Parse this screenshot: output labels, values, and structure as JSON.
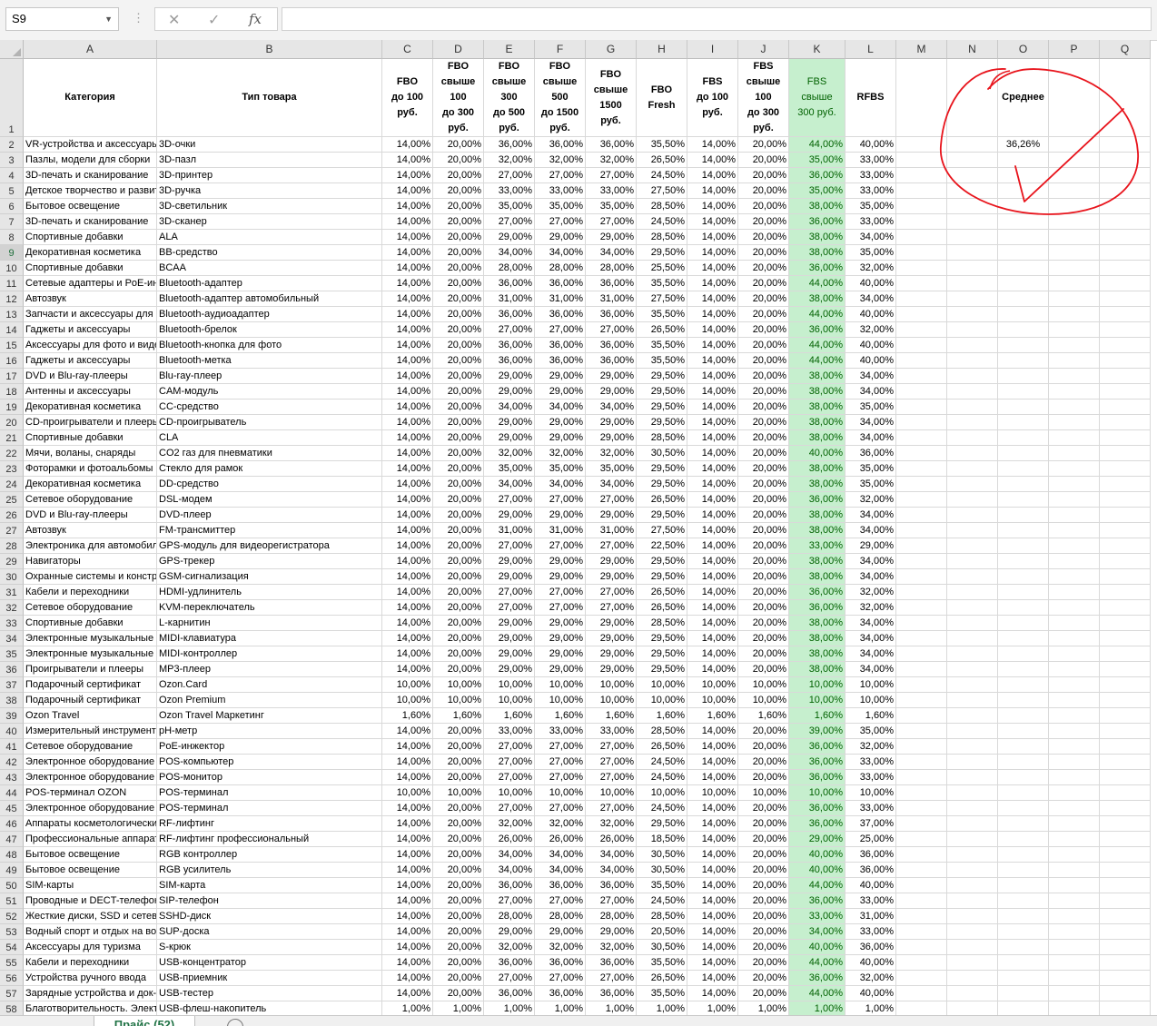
{
  "formula_bar": {
    "name_box": "S9",
    "cancel_icon": "cancel-icon",
    "enter_icon": "check-icon",
    "fx_label": "fx",
    "formula": ""
  },
  "selection": {
    "column": "S",
    "row": "9"
  },
  "columns": [
    "A",
    "B",
    "C",
    "D",
    "E",
    "F",
    "G",
    "H",
    "I",
    "J",
    "K",
    "L",
    "M",
    "N",
    "O",
    "P",
    "Q"
  ],
  "header_row": {
    "A": "Категория",
    "B": "Тип товара",
    "C": [
      "FBO",
      "до 100",
      "руб."
    ],
    "D": [
      "FBO",
      "свыше",
      "100",
      "до 300",
      "руб."
    ],
    "E": [
      "FBO",
      "свыше",
      "300",
      "до 500",
      "руб."
    ],
    "F": [
      "FBO",
      "свыше",
      "500",
      "до 1500",
      "руб."
    ],
    "G": [
      "FBO",
      "свыше",
      "1500",
      "руб."
    ],
    "H": [
      "FBO Fresh"
    ],
    "I": [
      "FBS",
      "до 100",
      "руб."
    ],
    "J": [
      "FBS",
      "свыше",
      "100",
      "до 300",
      "руб."
    ],
    "K": [
      "FBS",
      "свыше",
      "300 руб."
    ],
    "L": [
      "RFBS"
    ],
    "O": "Среднее"
  },
  "average_value": "36,26%",
  "rows": [
    [
      "VR-устройства и аксессуары",
      "3D-очки",
      "14,00%",
      "20,00%",
      "36,00%",
      "36,00%",
      "36,00%",
      "35,50%",
      "14,00%",
      "20,00%",
      "44,00%",
      "40,00%"
    ],
    [
      "Пазлы, модели для сборки",
      "3D-пазл",
      "14,00%",
      "20,00%",
      "32,00%",
      "32,00%",
      "32,00%",
      "26,50%",
      "14,00%",
      "20,00%",
      "35,00%",
      "33,00%"
    ],
    [
      "3D-печать и сканирование",
      "3D-принтер",
      "14,00%",
      "20,00%",
      "27,00%",
      "27,00%",
      "27,00%",
      "24,50%",
      "14,00%",
      "20,00%",
      "36,00%",
      "33,00%"
    ],
    [
      "Детское творчество и развитие",
      "3D-ручка",
      "14,00%",
      "20,00%",
      "33,00%",
      "33,00%",
      "33,00%",
      "27,50%",
      "14,00%",
      "20,00%",
      "35,00%",
      "33,00%"
    ],
    [
      "Бытовое освещение",
      "3D-светильник",
      "14,00%",
      "20,00%",
      "35,00%",
      "35,00%",
      "35,00%",
      "28,50%",
      "14,00%",
      "20,00%",
      "38,00%",
      "35,00%"
    ],
    [
      "3D-печать и сканирование",
      "3D-сканер",
      "14,00%",
      "20,00%",
      "27,00%",
      "27,00%",
      "27,00%",
      "24,50%",
      "14,00%",
      "20,00%",
      "36,00%",
      "33,00%"
    ],
    [
      "Спортивные добавки",
      "ALA",
      "14,00%",
      "20,00%",
      "29,00%",
      "29,00%",
      "29,00%",
      "28,50%",
      "14,00%",
      "20,00%",
      "38,00%",
      "34,00%"
    ],
    [
      "Декоративная косметика",
      "BB-средство",
      "14,00%",
      "20,00%",
      "34,00%",
      "34,00%",
      "34,00%",
      "29,50%",
      "14,00%",
      "20,00%",
      "38,00%",
      "35,00%"
    ],
    [
      "Спортивные добавки",
      "BCAA",
      "14,00%",
      "20,00%",
      "28,00%",
      "28,00%",
      "28,00%",
      "25,50%",
      "14,00%",
      "20,00%",
      "36,00%",
      "32,00%"
    ],
    [
      "Сетевые адаптеры и PoE-инжекторы",
      "Bluetooth-адаптер",
      "14,00%",
      "20,00%",
      "36,00%",
      "36,00%",
      "36,00%",
      "35,50%",
      "14,00%",
      "20,00%",
      "44,00%",
      "40,00%"
    ],
    [
      "Автозвук",
      "Bluetooth-адаптер автомобильный",
      "14,00%",
      "20,00%",
      "31,00%",
      "31,00%",
      "31,00%",
      "27,50%",
      "14,00%",
      "20,00%",
      "38,00%",
      "34,00%"
    ],
    [
      "Запчасти и аксессуары для аудио",
      "Bluetooth-аудиоадаптер",
      "14,00%",
      "20,00%",
      "36,00%",
      "36,00%",
      "36,00%",
      "35,50%",
      "14,00%",
      "20,00%",
      "44,00%",
      "40,00%"
    ],
    [
      "Гаджеты и аксессуары",
      "Bluetooth-брелок",
      "14,00%",
      "20,00%",
      "27,00%",
      "27,00%",
      "27,00%",
      "26,50%",
      "14,00%",
      "20,00%",
      "36,00%",
      "32,00%"
    ],
    [
      "Аксессуары для фото и видео",
      "Bluetooth-кнопка для фото",
      "14,00%",
      "20,00%",
      "36,00%",
      "36,00%",
      "36,00%",
      "35,50%",
      "14,00%",
      "20,00%",
      "44,00%",
      "40,00%"
    ],
    [
      "Гаджеты и аксессуары",
      "Bluetooth-метка",
      "14,00%",
      "20,00%",
      "36,00%",
      "36,00%",
      "36,00%",
      "35,50%",
      "14,00%",
      "20,00%",
      "44,00%",
      "40,00%"
    ],
    [
      "DVD и Blu-ray-плееры",
      "Blu-ray-плеер",
      "14,00%",
      "20,00%",
      "29,00%",
      "29,00%",
      "29,00%",
      "29,50%",
      "14,00%",
      "20,00%",
      "38,00%",
      "34,00%"
    ],
    [
      "Антенны и аксессуары",
      "CAM-модуль",
      "14,00%",
      "20,00%",
      "29,00%",
      "29,00%",
      "29,00%",
      "29,50%",
      "14,00%",
      "20,00%",
      "38,00%",
      "34,00%"
    ],
    [
      "Декоративная косметика",
      "CC-средство",
      "14,00%",
      "20,00%",
      "34,00%",
      "34,00%",
      "34,00%",
      "29,50%",
      "14,00%",
      "20,00%",
      "38,00%",
      "35,00%"
    ],
    [
      "CD-проигрыватели и плееры",
      "CD-проигрыватель",
      "14,00%",
      "20,00%",
      "29,00%",
      "29,00%",
      "29,00%",
      "29,50%",
      "14,00%",
      "20,00%",
      "38,00%",
      "34,00%"
    ],
    [
      "Спортивные добавки",
      "CLA",
      "14,00%",
      "20,00%",
      "29,00%",
      "29,00%",
      "29,00%",
      "28,50%",
      "14,00%",
      "20,00%",
      "38,00%",
      "34,00%"
    ],
    [
      "Мячи, воланы, снаряды",
      "CO2 газ для пневматики",
      "14,00%",
      "20,00%",
      "32,00%",
      "32,00%",
      "32,00%",
      "30,50%",
      "14,00%",
      "20,00%",
      "40,00%",
      "36,00%"
    ],
    [
      "Фоторамки и фотоальбомы",
      "Стекло для рамок",
      "14,00%",
      "20,00%",
      "35,00%",
      "35,00%",
      "35,00%",
      "29,50%",
      "14,00%",
      "20,00%",
      "38,00%",
      "35,00%"
    ],
    [
      "Декоративная косметика",
      "DD-средство",
      "14,00%",
      "20,00%",
      "34,00%",
      "34,00%",
      "34,00%",
      "29,50%",
      "14,00%",
      "20,00%",
      "38,00%",
      "35,00%"
    ],
    [
      "Сетевое оборудование",
      "DSL-модем",
      "14,00%",
      "20,00%",
      "27,00%",
      "27,00%",
      "27,00%",
      "26,50%",
      "14,00%",
      "20,00%",
      "36,00%",
      "32,00%"
    ],
    [
      "DVD и Blu-ray-плееры",
      "DVD-плеер",
      "14,00%",
      "20,00%",
      "29,00%",
      "29,00%",
      "29,00%",
      "29,50%",
      "14,00%",
      "20,00%",
      "38,00%",
      "34,00%"
    ],
    [
      "Автозвук",
      "FM-трансмиттер",
      "14,00%",
      "20,00%",
      "31,00%",
      "31,00%",
      "31,00%",
      "27,50%",
      "14,00%",
      "20,00%",
      "38,00%",
      "34,00%"
    ],
    [
      "Электроника для автомобилей",
      "GPS-модуль для видеорегистратора",
      "14,00%",
      "20,00%",
      "27,00%",
      "27,00%",
      "27,00%",
      "22,50%",
      "14,00%",
      "20,00%",
      "33,00%",
      "29,00%"
    ],
    [
      "Навигаторы",
      "GPS-трекер",
      "14,00%",
      "20,00%",
      "29,00%",
      "29,00%",
      "29,00%",
      "29,50%",
      "14,00%",
      "20,00%",
      "38,00%",
      "34,00%"
    ],
    [
      "Охранные системы и конструкции",
      "GSM-сигнализация",
      "14,00%",
      "20,00%",
      "29,00%",
      "29,00%",
      "29,00%",
      "29,50%",
      "14,00%",
      "20,00%",
      "38,00%",
      "34,00%"
    ],
    [
      "Кабели и переходники",
      "HDMI-удлинитель",
      "14,00%",
      "20,00%",
      "27,00%",
      "27,00%",
      "27,00%",
      "26,50%",
      "14,00%",
      "20,00%",
      "36,00%",
      "32,00%"
    ],
    [
      "Сетевое оборудование",
      "KVM-переключатель",
      "14,00%",
      "20,00%",
      "27,00%",
      "27,00%",
      "27,00%",
      "26,50%",
      "14,00%",
      "20,00%",
      "36,00%",
      "32,00%"
    ],
    [
      "Спортивные добавки",
      "L-карнитин",
      "14,00%",
      "20,00%",
      "29,00%",
      "29,00%",
      "29,00%",
      "28,50%",
      "14,00%",
      "20,00%",
      "38,00%",
      "34,00%"
    ],
    [
      "Электронные музыкальные инструменты",
      "MIDI-клавиатура",
      "14,00%",
      "20,00%",
      "29,00%",
      "29,00%",
      "29,00%",
      "29,50%",
      "14,00%",
      "20,00%",
      "38,00%",
      "34,00%"
    ],
    [
      "Электронные музыкальные инструменты",
      "MIDI-контроллер",
      "14,00%",
      "20,00%",
      "29,00%",
      "29,00%",
      "29,00%",
      "29,50%",
      "14,00%",
      "20,00%",
      "38,00%",
      "34,00%"
    ],
    [
      "Проигрыватели и плееры",
      "MP3-плеер",
      "14,00%",
      "20,00%",
      "29,00%",
      "29,00%",
      "29,00%",
      "29,50%",
      "14,00%",
      "20,00%",
      "38,00%",
      "34,00%"
    ],
    [
      "Подарочный сертификат",
      "Ozon.Card",
      "10,00%",
      "10,00%",
      "10,00%",
      "10,00%",
      "10,00%",
      "10,00%",
      "10,00%",
      "10,00%",
      "10,00%",
      "10,00%"
    ],
    [
      "Подарочный сертификат",
      "Ozon Premium",
      "10,00%",
      "10,00%",
      "10,00%",
      "10,00%",
      "10,00%",
      "10,00%",
      "10,00%",
      "10,00%",
      "10,00%",
      "10,00%"
    ],
    [
      "Ozon Travel",
      "Ozon Travel Маркетинг",
      "1,60%",
      "1,60%",
      "1,60%",
      "1,60%",
      "1,60%",
      "1,60%",
      "1,60%",
      "1,60%",
      "1,60%",
      "1,60%"
    ],
    [
      "Измерительный инструмент",
      "pH-метр",
      "14,00%",
      "20,00%",
      "33,00%",
      "33,00%",
      "33,00%",
      "28,50%",
      "14,00%",
      "20,00%",
      "39,00%",
      "35,00%"
    ],
    [
      "Сетевое оборудование",
      "PoE-инжектор",
      "14,00%",
      "20,00%",
      "27,00%",
      "27,00%",
      "27,00%",
      "26,50%",
      "14,00%",
      "20,00%",
      "36,00%",
      "32,00%"
    ],
    [
      "Электронное оборудование",
      "POS-компьютер",
      "14,00%",
      "20,00%",
      "27,00%",
      "27,00%",
      "27,00%",
      "24,50%",
      "14,00%",
      "20,00%",
      "36,00%",
      "33,00%"
    ],
    [
      "Электронное оборудование",
      "POS-монитор",
      "14,00%",
      "20,00%",
      "27,00%",
      "27,00%",
      "27,00%",
      "24,50%",
      "14,00%",
      "20,00%",
      "36,00%",
      "33,00%"
    ],
    [
      "POS-терминал OZON",
      "POS-терминал",
      "10,00%",
      "10,00%",
      "10,00%",
      "10,00%",
      "10,00%",
      "10,00%",
      "10,00%",
      "10,00%",
      "10,00%",
      "10,00%"
    ],
    [
      "Электронное оборудование",
      "POS-терминал",
      "14,00%",
      "20,00%",
      "27,00%",
      "27,00%",
      "27,00%",
      "24,50%",
      "14,00%",
      "20,00%",
      "36,00%",
      "33,00%"
    ],
    [
      "Аппараты косметологические",
      "RF-лифтинг",
      "14,00%",
      "20,00%",
      "32,00%",
      "32,00%",
      "32,00%",
      "29,50%",
      "14,00%",
      "20,00%",
      "36,00%",
      "37,00%"
    ],
    [
      "Профессиональные аппараты",
      "RF-лифтинг профессиональный",
      "14,00%",
      "20,00%",
      "26,00%",
      "26,00%",
      "26,00%",
      "18,50%",
      "14,00%",
      "20,00%",
      "29,00%",
      "25,00%"
    ],
    [
      "Бытовое освещение",
      "RGB контроллер",
      "14,00%",
      "20,00%",
      "34,00%",
      "34,00%",
      "34,00%",
      "30,50%",
      "14,00%",
      "20,00%",
      "40,00%",
      "36,00%"
    ],
    [
      "Бытовое освещение",
      "RGB усилитель",
      "14,00%",
      "20,00%",
      "34,00%",
      "34,00%",
      "34,00%",
      "30,50%",
      "14,00%",
      "20,00%",
      "40,00%",
      "36,00%"
    ],
    [
      "SIM-карты",
      "SIM-карта",
      "14,00%",
      "20,00%",
      "36,00%",
      "36,00%",
      "36,00%",
      "35,50%",
      "14,00%",
      "20,00%",
      "44,00%",
      "40,00%"
    ],
    [
      "Проводные и DECT-телефоны",
      "SIP-телефон",
      "14,00%",
      "20,00%",
      "27,00%",
      "27,00%",
      "27,00%",
      "24,50%",
      "14,00%",
      "20,00%",
      "36,00%",
      "33,00%"
    ],
    [
      "Жесткие диски, SSD и сетевые",
      "SSHD-диск",
      "14,00%",
      "20,00%",
      "28,00%",
      "28,00%",
      "28,00%",
      "28,50%",
      "14,00%",
      "20,00%",
      "33,00%",
      "31,00%"
    ],
    [
      "Водный спорт и отдых на воде",
      "SUP-доска",
      "14,00%",
      "20,00%",
      "29,00%",
      "29,00%",
      "29,00%",
      "20,50%",
      "14,00%",
      "20,00%",
      "34,00%",
      "33,00%"
    ],
    [
      "Аксессуары для туризма",
      "S-крюк",
      "14,00%",
      "20,00%",
      "32,00%",
      "32,00%",
      "32,00%",
      "30,50%",
      "14,00%",
      "20,00%",
      "40,00%",
      "36,00%"
    ],
    [
      "Кабели и переходники",
      "USB-концентратор",
      "14,00%",
      "20,00%",
      "36,00%",
      "36,00%",
      "36,00%",
      "35,50%",
      "14,00%",
      "20,00%",
      "44,00%",
      "40,00%"
    ],
    [
      "Устройства ручного ввода",
      "USB-приемник",
      "14,00%",
      "20,00%",
      "27,00%",
      "27,00%",
      "27,00%",
      "26,50%",
      "14,00%",
      "20,00%",
      "36,00%",
      "32,00%"
    ],
    [
      "Зарядные устройства и док-станции",
      "USB-тестер",
      "14,00%",
      "20,00%",
      "36,00%",
      "36,00%",
      "36,00%",
      "35,50%",
      "14,00%",
      "20,00%",
      "44,00%",
      "40,00%"
    ],
    [
      "Благотворительность. Электроника",
      "USB-флеш-накопитель",
      "1,00%",
      "1,00%",
      "1,00%",
      "1,00%",
      "1,00%",
      "1,00%",
      "1,00%",
      "1,00%",
      "1,00%",
      "1,00%"
    ]
  ],
  "sheet_tab": "Прайс (52)",
  "annotation": {
    "shape": "hand-drawn circle with check mark",
    "color": "#e8141c"
  }
}
